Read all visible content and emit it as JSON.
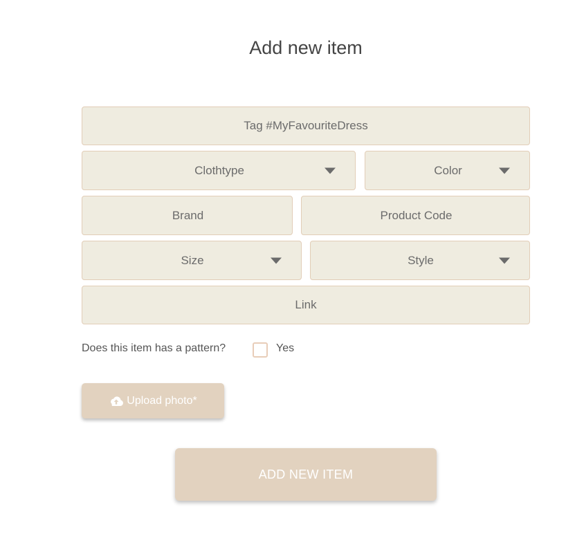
{
  "page_title": "Add new item",
  "fields": {
    "tag": "Tag #MyFavouriteDress",
    "clothtype": "Clothtype",
    "color": "Color",
    "brand": "Brand",
    "product_code": "Product Code",
    "size": "Size",
    "style": "Style",
    "link": "Link"
  },
  "pattern": {
    "question": "Does this item has a pattern?",
    "option_label": "Yes",
    "checked": false
  },
  "upload": {
    "label": "Upload photo*",
    "icon": "cloud-upload-icon"
  },
  "submit": {
    "label": "ADD NEW ITEM"
  },
  "colors": {
    "field_bg": "#efece0",
    "field_border": "#e2cdb7",
    "button_bg": "#e2d2bf",
    "button_text": "#ffffff"
  }
}
